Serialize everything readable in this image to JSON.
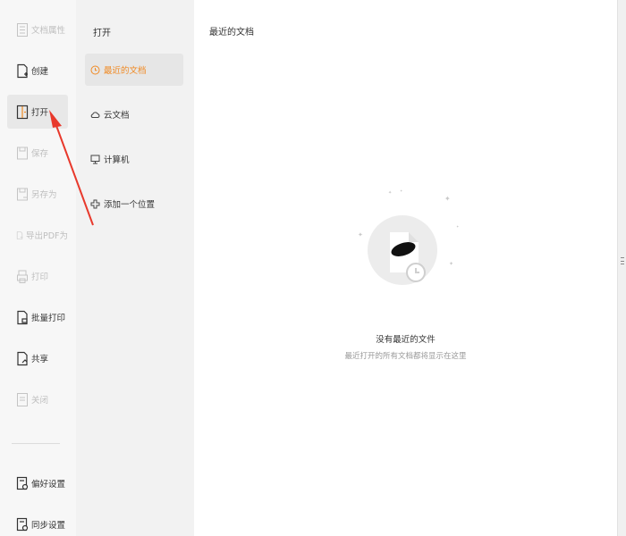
{
  "left_menu": {
    "items": [
      {
        "label": "文档属性",
        "state": "disabled"
      },
      {
        "label": "创建",
        "state": "normal"
      },
      {
        "label": "打开",
        "state": "active"
      },
      {
        "label": "保存",
        "state": "disabled"
      },
      {
        "label": "另存为",
        "state": "disabled"
      },
      {
        "label": "导出PDF为",
        "state": "disabled"
      },
      {
        "label": "打印",
        "state": "disabled"
      },
      {
        "label": "批量打印",
        "state": "normal"
      },
      {
        "label": "共享",
        "state": "normal"
      },
      {
        "label": "关闭",
        "state": "disabled"
      },
      {
        "label": "偏好设置",
        "state": "normal"
      },
      {
        "label": "同步设置",
        "state": "normal"
      }
    ]
  },
  "open_panel": {
    "title": "打开",
    "items": [
      {
        "label": "最近的文档",
        "icon": "clock-icon",
        "state": "active"
      },
      {
        "label": "云文档",
        "icon": "cloud-icon",
        "state": "normal"
      },
      {
        "label": "计算机",
        "icon": "computer-icon",
        "state": "normal"
      },
      {
        "label": "添加一个位置",
        "icon": "plus-icon",
        "state": "normal"
      }
    ]
  },
  "recent": {
    "title": "最近的文档",
    "empty_title": "没有最近的文件",
    "empty_subtitle": "最近打开的所有文档都将显示在这里"
  },
  "colors": {
    "accent": "#f08a24",
    "annotation": "#e8392c"
  }
}
